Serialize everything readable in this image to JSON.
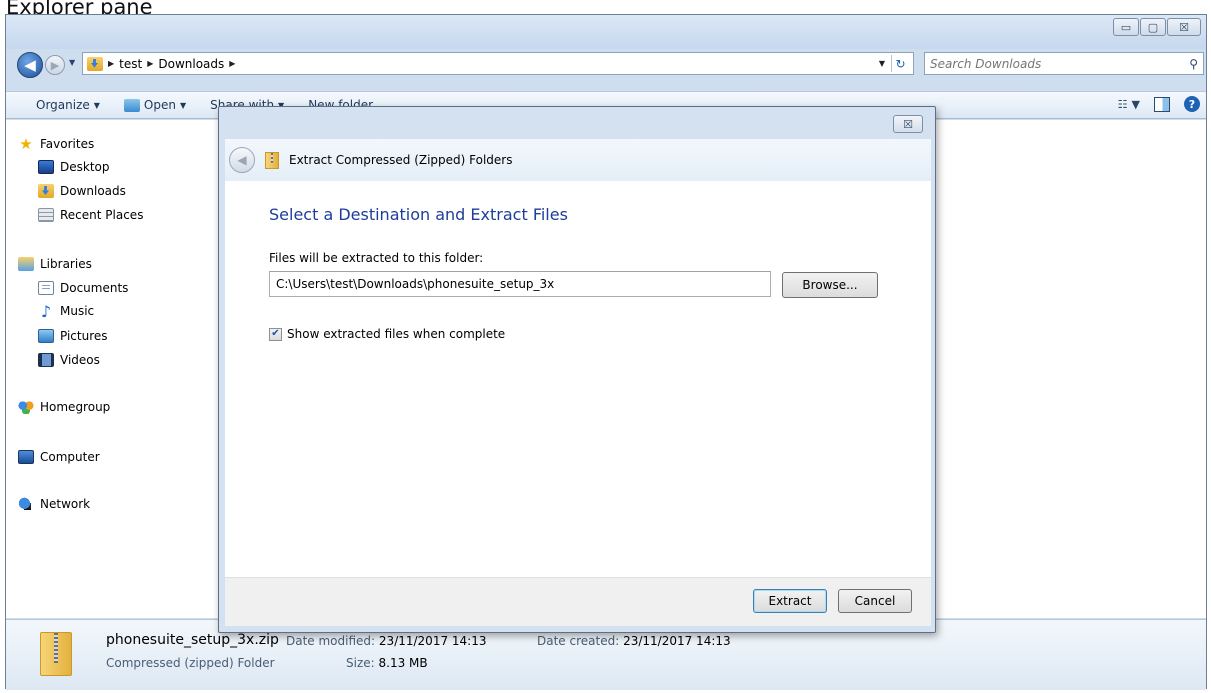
{
  "header_text": "Explorer pane",
  "window": {
    "caption_buttons": {
      "minimize": "▭",
      "maximize": "▢",
      "close": "☒"
    }
  },
  "address": {
    "crumbs": [
      "test",
      "Downloads"
    ],
    "search_placeholder": "Search Downloads"
  },
  "toolbar": {
    "organize": "Organize",
    "open": "Open",
    "share_with": "Share with",
    "new_folder": "New folder"
  },
  "nav": {
    "favorites": "Favorites",
    "desktop": "Desktop",
    "downloads": "Downloads",
    "recent_places": "Recent Places",
    "libraries": "Libraries",
    "documents": "Documents",
    "music": "Music",
    "pictures": "Pictures",
    "videos": "Videos",
    "homegroup": "Homegroup",
    "computer": "Computer",
    "network": "Network"
  },
  "details": {
    "file_name": "phonesuite_setup_3x.zip",
    "file_type": "Compressed (zipped) Folder",
    "date_modified_label": "Date modified:",
    "date_modified": "23/11/2017 14:13",
    "date_created_label": "Date created:",
    "date_created": "23/11/2017 14:13",
    "size_label": "Size:",
    "size": "8.13 MB"
  },
  "dialog": {
    "close_glyph": "☒",
    "title": "Extract Compressed (Zipped) Folders",
    "heading": "Select a Destination and Extract Files",
    "label": "Files will be extracted to this folder:",
    "destination": "C:\\Users\\test\\Downloads\\phonesuite_setup_3x",
    "browse": "Browse...",
    "show_files_label": "Show extracted files when complete",
    "show_files_checked": true,
    "extract": "Extract",
    "cancel": "Cancel"
  }
}
